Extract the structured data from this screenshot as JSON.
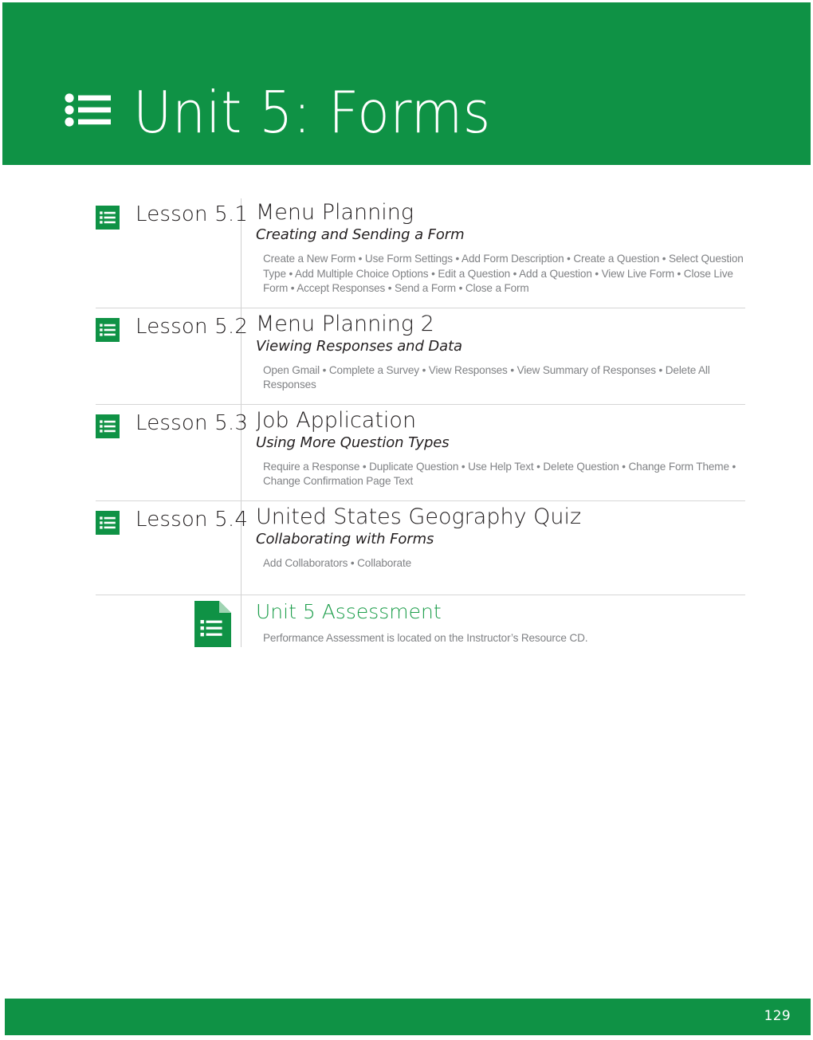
{
  "header": {
    "title": "Unit 5: Forms",
    "icon": "forms-list-icon",
    "background_color": "#0f9245",
    "text_color": "#ffffff"
  },
  "lessons": [
    {
      "icon": "google-forms-icon",
      "label": "Lesson 5.1",
      "title": "Menu Planning",
      "subtitle": "Creating and Sending a Form",
      "topics": "Create a New Form • Use Form Settings • Add Form Description • Create a Question • Select Question Type • Add Multiple Choice Options • Edit a Question • Add a Question • View Live Form • Close Live Form • Accept Responses • Send a Form • Close a Form"
    },
    {
      "icon": "google-forms-icon",
      "label": "Lesson 5.2",
      "title": "Menu Planning 2",
      "subtitle": "Viewing Responses and Data",
      "topics": "Open Gmail • Complete a Survey • View Responses • View Summary of Responses • Delete All Responses"
    },
    {
      "icon": "google-forms-icon",
      "label": "Lesson 5.3",
      "title": "Job Application",
      "subtitle": "Using More Question Types",
      "topics": "Require a Response • Duplicate Question • Use Help Text • Delete Question • Change Form Theme • Change Confirmation Page Text"
    },
    {
      "icon": "google-forms-icon",
      "label": "Lesson 5.4",
      "title": "United States Geography Quiz",
      "subtitle": "Collaborating with Forms",
      "topics": "Add Collaborators • Collaborate"
    }
  ],
  "assessment": {
    "icon": "forms-document-icon",
    "title": "Unit 5 Assessment",
    "note": "Performance Assessment is located on the Instructor’s Resource CD.",
    "title_color": "#1d9e4b"
  },
  "footer": {
    "page_number": "129",
    "background_color": "#0f9245"
  }
}
